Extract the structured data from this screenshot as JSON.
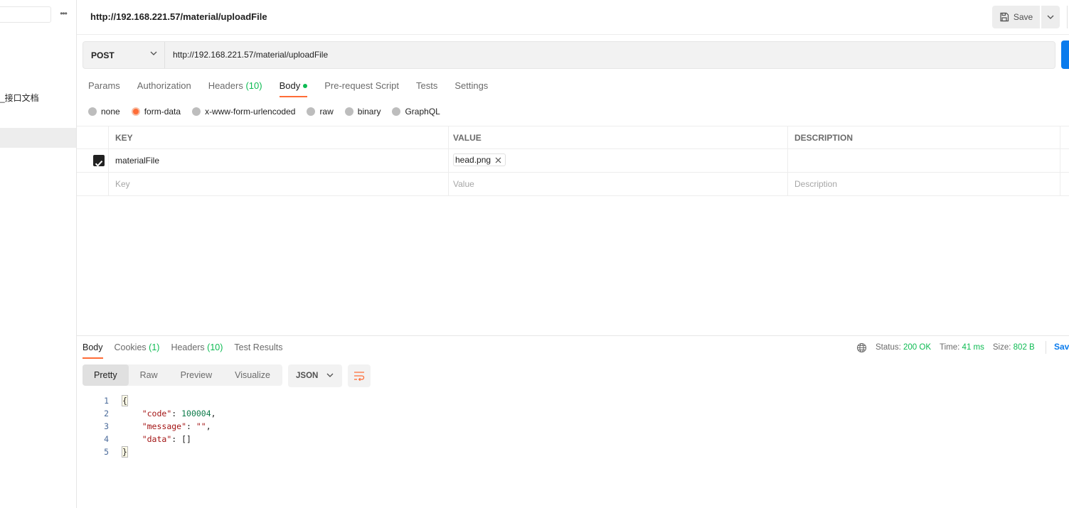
{
  "sidebar": {
    "more_label": "•••",
    "item_label": "_接口文档"
  },
  "header": {
    "title": "http://192.168.221.57/material/uploadFile",
    "save_label": "Save"
  },
  "request": {
    "method": "POST",
    "url": "http://192.168.221.57/material/uploadFile"
  },
  "tabs": [
    {
      "label": "Params"
    },
    {
      "label": "Authorization"
    },
    {
      "label": "Headers",
      "count": "(10)"
    },
    {
      "label": "Body",
      "active": true
    },
    {
      "label": "Pre-request Script"
    },
    {
      "label": "Tests"
    },
    {
      "label": "Settings"
    }
  ],
  "body_types": [
    {
      "label": "none"
    },
    {
      "label": "form-data",
      "selected": true
    },
    {
      "label": "x-www-form-urlencoded"
    },
    {
      "label": "raw"
    },
    {
      "label": "binary"
    },
    {
      "label": "GraphQL"
    }
  ],
  "params": {
    "headers": {
      "key": "KEY",
      "value": "VALUE",
      "description": "DESCRIPTION"
    },
    "rows": [
      {
        "key": "materialFile",
        "file": "head.png",
        "description": "",
        "checked": true
      }
    ],
    "placeholders": {
      "key": "Key",
      "value": "Value",
      "description": "Description"
    }
  },
  "response": {
    "tabs": [
      {
        "label": "Body",
        "active": true
      },
      {
        "label": "Cookies",
        "count": "(1)"
      },
      {
        "label": "Headers",
        "count": "(10)"
      },
      {
        "label": "Test Results"
      }
    ],
    "status_label": "Status:",
    "status_value": "200 OK",
    "time_label": "Time:",
    "time_value": "41 ms",
    "size_label": "Size:",
    "size_value": "802 B",
    "save_label": "Sav",
    "views": [
      "Pretty",
      "Raw",
      "Preview",
      "Visualize"
    ],
    "format": "JSON",
    "code": {
      "line_numbers": [
        "1",
        "2",
        "3",
        "4",
        "5"
      ],
      "open_brace": "{",
      "close_brace": "}",
      "code_key": "\"code\"",
      "code_value": "100004",
      "message_key": "\"message\"",
      "message_value": "\"\"",
      "data_key": "\"data\"",
      "data_value": "[]"
    }
  },
  "colors": {
    "accent": "#ff6c37",
    "success": "#0cbb52",
    "link": "#097bed"
  }
}
